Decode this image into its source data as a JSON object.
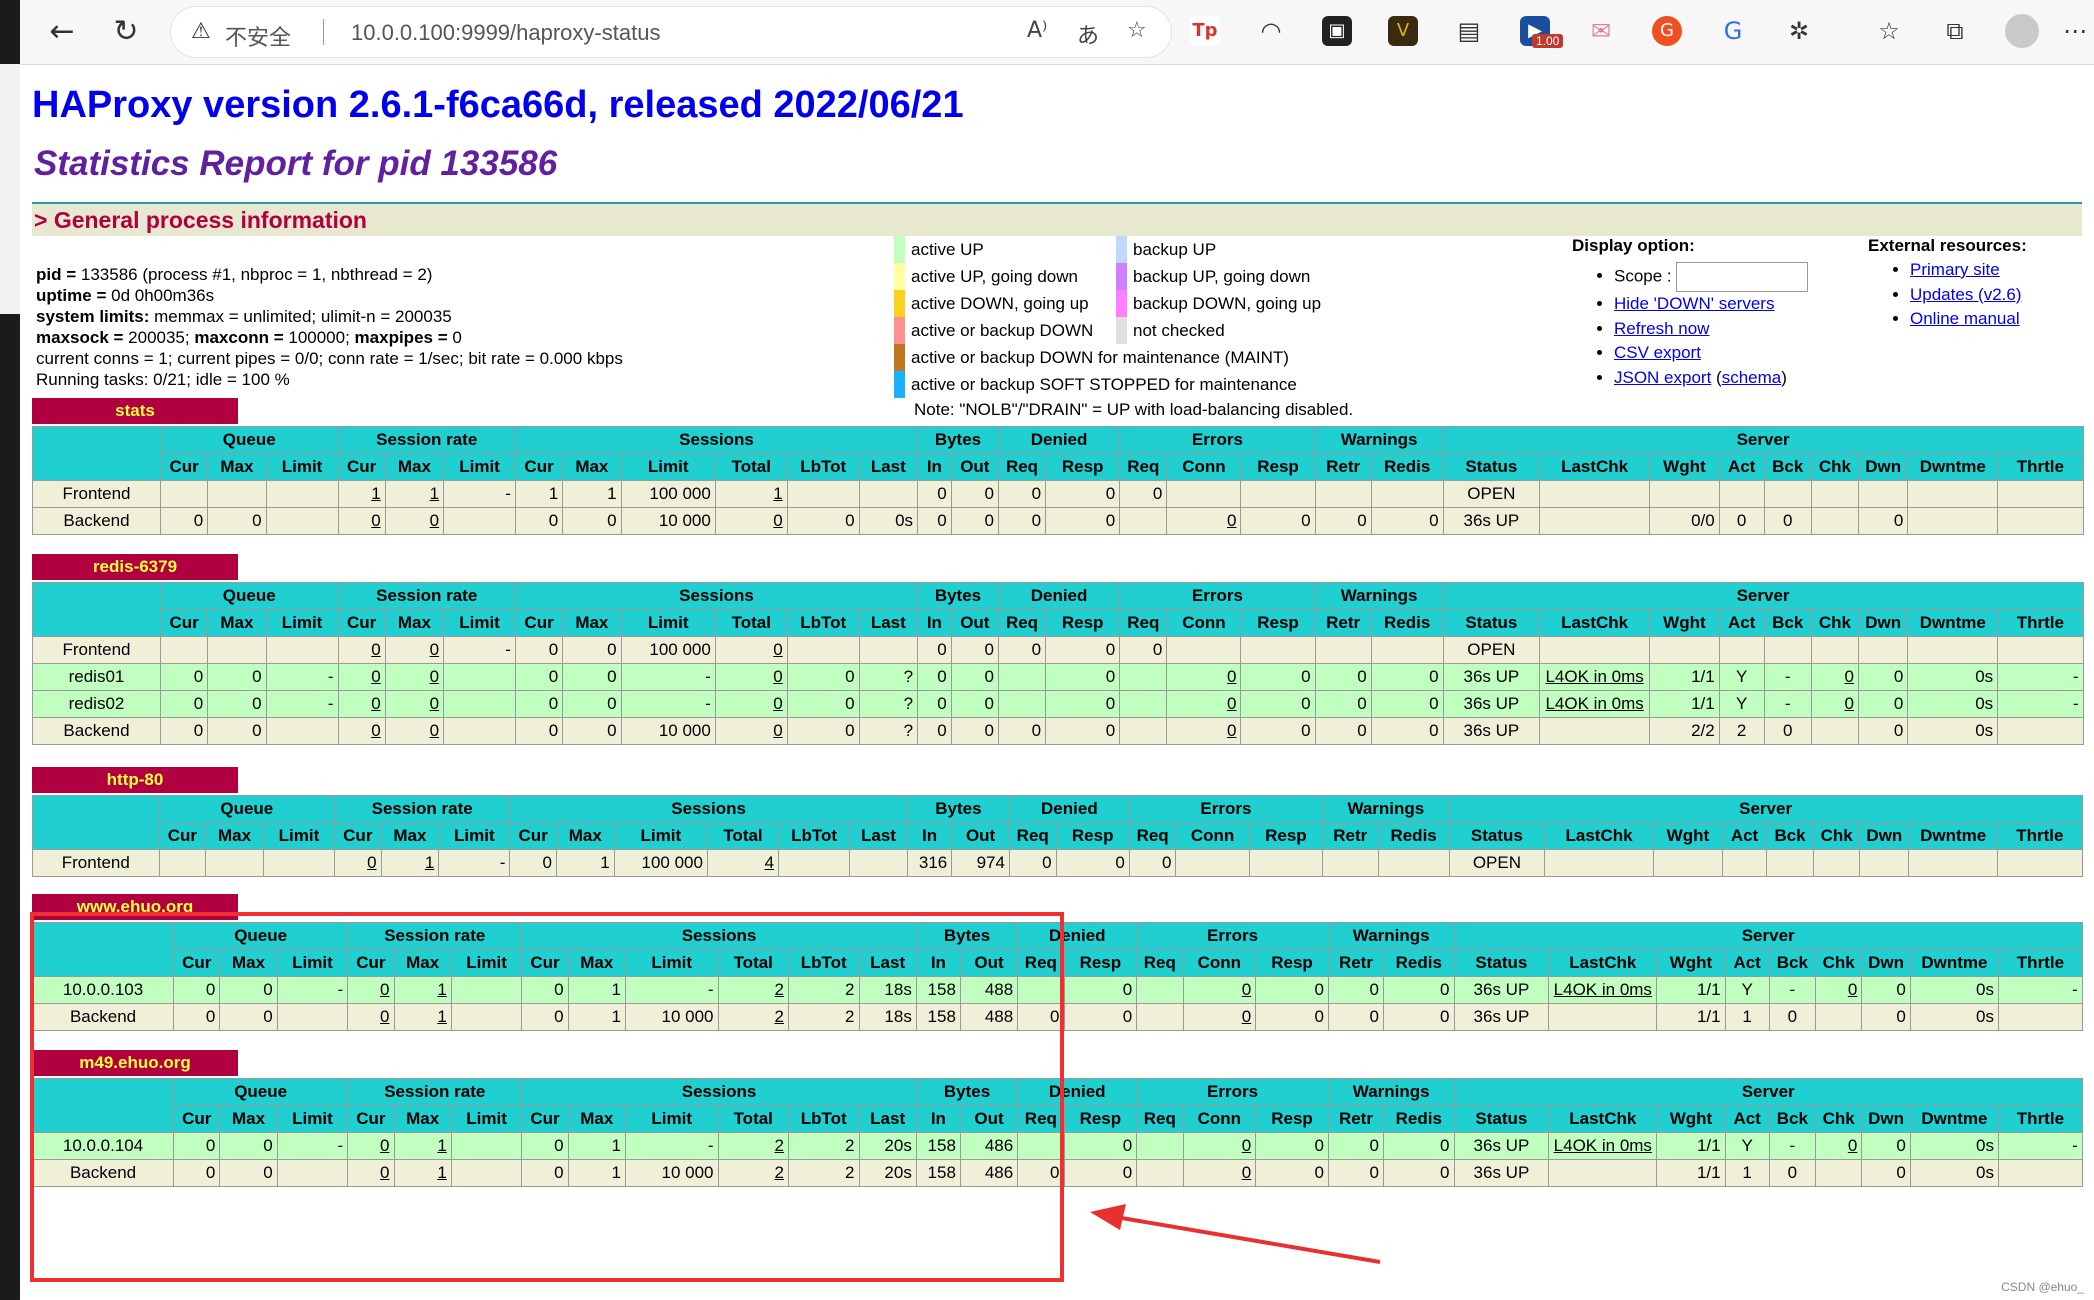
{
  "browser": {
    "security_label": "不安全",
    "url": "10.0.0.100:9999/haproxy-status",
    "extension_badge": "1.00"
  },
  "page": {
    "title": "HAProxy version 2.6.1-f6ca66d, released 2022/06/21",
    "subtitle": "Statistics Report for pid 133586",
    "section_general": "> General process information"
  },
  "process_info": {
    "line1_label": "pid = ",
    "line1_value": "133586 (process #1, nbproc = 1, nbthread = 2)",
    "line2_label": "uptime = ",
    "line2_value": "0d 0h00m36s",
    "line3_label": "system limits: ",
    "line3_value": "memmax = unlimited; ulimit-n = 200035",
    "line4_a": "maxsock = ",
    "line4_av": "200035; ",
    "line4_b": "maxconn = ",
    "line4_bv": "100000; ",
    "line4_c": "maxpipes = ",
    "line4_cv": "0",
    "line5": "current conns = 1; current pipes = 0/0; conn rate = 1/sec; bit rate = 0.000 kbps",
    "line6": "Running tasks: 0/21; idle = 100 %"
  },
  "legend": {
    "col1": [
      {
        "label": "active UP",
        "color": "#c0ffc0"
      },
      {
        "label": "active UP, going down",
        "color": "#ffffa0"
      },
      {
        "label": "active DOWN, going up",
        "color": "#ffd020"
      },
      {
        "label": "active or backup DOWN",
        "color": "#ff9090"
      },
      {
        "label": "active or backup DOWN for maintenance (MAINT)",
        "color": "#c07820"
      },
      {
        "label": "active or backup SOFT STOPPED for maintenance",
        "color": "#1ab2ff"
      }
    ],
    "col2": [
      {
        "label": "backup UP",
        "color": "#c0d8ff"
      },
      {
        "label": "backup UP, going down",
        "color": "#d080ff"
      },
      {
        "label": "backup DOWN, going up",
        "color": "#ff80ff"
      },
      {
        "label": "not checked",
        "color": "#e0e0e0"
      }
    ],
    "note": "Note: \"NOLB\"/\"DRAIN\" = UP with load-balancing disabled."
  },
  "display_option": {
    "title": "Display option:",
    "scope_label": "Scope :",
    "links": [
      "Hide 'DOWN' servers",
      "Refresh now",
      "CSV export",
      "JSON export"
    ],
    "schema_open": " (",
    "schema_link": "schema",
    "schema_close": ")"
  },
  "external_resources": {
    "title": "External resources:",
    "links": [
      "Primary site",
      "Updates (v2.6)",
      "Online manual"
    ]
  },
  "table_headers": {
    "groups": [
      "Queue",
      "Session rate",
      "Sessions",
      "Bytes",
      "Denied",
      "Errors",
      "Warnings",
      "Server"
    ],
    "sub": [
      "Cur",
      "Max",
      "Limit",
      "Cur",
      "Max",
      "Limit",
      "Cur",
      "Max",
      "Limit",
      "Total",
      "LbTot",
      "Last",
      "In",
      "Out",
      "Req",
      "Resp",
      "Req",
      "Conn",
      "Resp",
      "Retr",
      "Redis",
      "Status",
      "LastChk",
      "Wght",
      "Act",
      "Bck",
      "Chk",
      "Dwn",
      "Dwntme",
      "Thrtle"
    ]
  },
  "proxies": [
    {
      "name": "stats",
      "rows": [
        {
          "kind": "fe",
          "cells": [
            "Frontend",
            "",
            "",
            "",
            "1",
            "1",
            "-",
            "1",
            "1",
            "100 000",
            "1",
            "",
            "",
            "0",
            "0",
            "0",
            "0",
            "0",
            "",
            "",
            "",
            "",
            "OPEN",
            "",
            "",
            "",
            "",
            "",
            "",
            "",
            ""
          ]
        },
        {
          "kind": "be",
          "cells": [
            "Backend",
            "0",
            "0",
            "",
            "0",
            "0",
            "",
            "0",
            "0",
            "10 000",
            "0",
            "0",
            "0s",
            "0",
            "0",
            "0",
            "0",
            "",
            "0",
            "0",
            "0",
            "0",
            "36s UP",
            "",
            "0/0",
            "0",
            "0",
            "",
            "0",
            "",
            ""
          ]
        }
      ]
    },
    {
      "name": "redis-6379",
      "rows": [
        {
          "kind": "fe",
          "cells": [
            "Frontend",
            "",
            "",
            "",
            "0",
            "0",
            "-",
            "0",
            "0",
            "100 000",
            "0",
            "",
            "",
            "0",
            "0",
            "0",
            "0",
            "0",
            "",
            "",
            "",
            "",
            "OPEN",
            "",
            "",
            "",
            "",
            "",
            "",
            "",
            ""
          ]
        },
        {
          "kind": "srv",
          "cells": [
            "redis01",
            "0",
            "0",
            "-",
            "0",
            "0",
            "",
            "0",
            "0",
            "-",
            "0",
            "0",
            "?",
            "0",
            "0",
            "",
            "0",
            "",
            "0",
            "0",
            "0",
            "0",
            "36s UP",
            "L4OK in 0ms",
            "1/1",
            "Y",
            "-",
            "0",
            "0",
            "0s",
            "-"
          ]
        },
        {
          "kind": "srv",
          "cells": [
            "redis02",
            "0",
            "0",
            "-",
            "0",
            "0",
            "",
            "0",
            "0",
            "-",
            "0",
            "0",
            "?",
            "0",
            "0",
            "",
            "0",
            "",
            "0",
            "0",
            "0",
            "0",
            "36s UP",
            "L4OK in 0ms",
            "1/1",
            "Y",
            "-",
            "0",
            "0",
            "0s",
            "-"
          ]
        },
        {
          "kind": "be",
          "cells": [
            "Backend",
            "0",
            "0",
            "",
            "0",
            "0",
            "",
            "0",
            "0",
            "10 000",
            "0",
            "0",
            "?",
            "0",
            "0",
            "0",
            "0",
            "",
            "0",
            "0",
            "0",
            "0",
            "36s UP",
            "",
            "2/2",
            "2",
            "0",
            "",
            "0",
            "0s",
            ""
          ]
        }
      ]
    },
    {
      "name": "http-80",
      "rows": [
        {
          "kind": "fe",
          "cells": [
            "Frontend",
            "",
            "",
            "",
            "0",
            "1",
            "-",
            "0",
            "1",
            "100 000",
            "4",
            "",
            "",
            "316",
            "974",
            "0",
            "0",
            "0",
            "",
            "",
            "",
            "",
            "OPEN",
            "",
            "",
            "",
            "",
            "",
            "",
            "",
            ""
          ]
        }
      ]
    },
    {
      "name": "www.ehuo.org",
      "rows": [
        {
          "kind": "srv",
          "cells": [
            "10.0.0.103",
            "0",
            "0",
            "-",
            "0",
            "1",
            "",
            "0",
            "1",
            "-",
            "2",
            "2",
            "18s",
            "158",
            "488",
            "",
            "0",
            "",
            "0",
            "0",
            "0",
            "0",
            "36s UP",
            "L4OK in 0ms",
            "1/1",
            "Y",
            "-",
            "0",
            "0",
            "0s",
            "-"
          ]
        },
        {
          "kind": "be",
          "cells": [
            "Backend",
            "0",
            "0",
            "",
            "0",
            "1",
            "",
            "0",
            "1",
            "10 000",
            "2",
            "2",
            "18s",
            "158",
            "488",
            "0",
            "0",
            "",
            "0",
            "0",
            "0",
            "0",
            "36s UP",
            "",
            "1/1",
            "1",
            "0",
            "",
            "0",
            "0s",
            ""
          ]
        }
      ]
    },
    {
      "name": "m49.ehuo.org",
      "rows": [
        {
          "kind": "srv",
          "cells": [
            "10.0.0.104",
            "0",
            "0",
            "-",
            "0",
            "1",
            "",
            "0",
            "1",
            "-",
            "2",
            "2",
            "20s",
            "158",
            "486",
            "",
            "0",
            "",
            "0",
            "0",
            "0",
            "0",
            "36s UP",
            "L4OK in 0ms",
            "1/1",
            "Y",
            "-",
            "0",
            "0",
            "0s",
            "-"
          ]
        },
        {
          "kind": "be",
          "cells": [
            "Backend",
            "0",
            "0",
            "",
            "0",
            "1",
            "",
            "0",
            "1",
            "10 000",
            "2",
            "2",
            "20s",
            "158",
            "486",
            "0",
            "0",
            "",
            "0",
            "0",
            "0",
            "0",
            "36s UP",
            "",
            "1/1",
            "1",
            "0",
            "",
            "0",
            "0s",
            ""
          ]
        }
      ]
    }
  ],
  "watermark": "CSDN @ehuo_"
}
